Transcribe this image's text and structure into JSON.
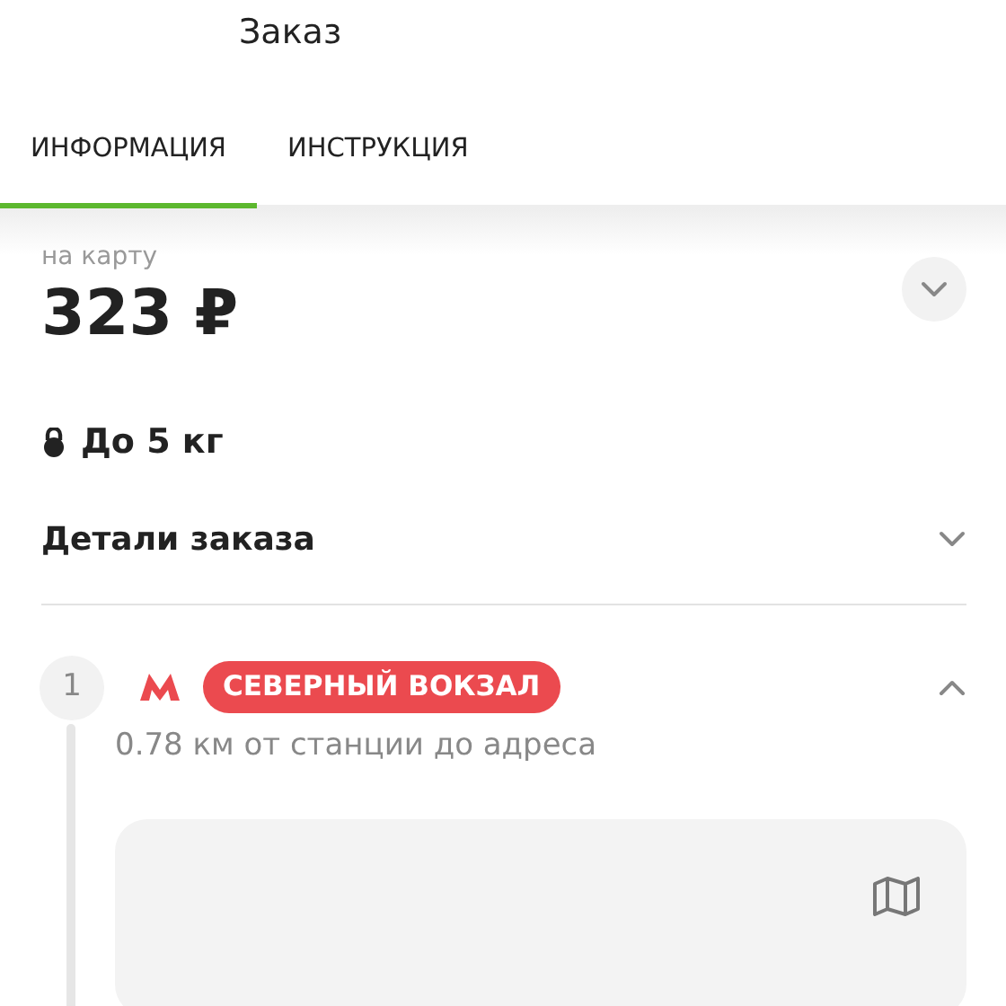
{
  "header": {
    "title": "Заказ"
  },
  "tabs": [
    {
      "label": "ИНФОРМАЦИЯ",
      "selected": true
    },
    {
      "label": "ИНСТРУКЦИЯ",
      "selected": false
    }
  ],
  "payment": {
    "caption": "на карту",
    "amount": "323 ₽",
    "expanded": false
  },
  "weight": "До 5 кг",
  "details": {
    "label": "Детали заказа",
    "expanded": false
  },
  "stops": [
    {
      "number": "1",
      "station": "СЕВЕРНЫЙ ВОКЗАЛ",
      "color": "#eb4a4f",
      "distance": "0.78 км от станции до адреса",
      "expanded": true
    }
  ]
}
